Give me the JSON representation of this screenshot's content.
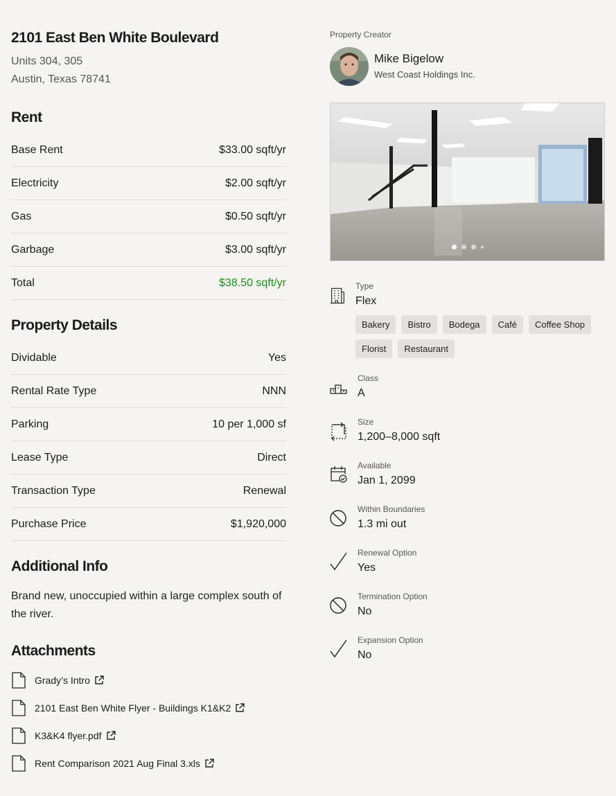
{
  "header": {
    "title": "2101 East Ben White Boulevard",
    "address_line1": "Units 304, 305",
    "address_line2": "Austin, Texas 78741"
  },
  "rent": {
    "heading": "Rent",
    "rows": [
      {
        "label": "Base Rent",
        "value": "$33.00 sqft/yr"
      },
      {
        "label": "Electricity",
        "value": "$2.00 sqft/yr"
      },
      {
        "label": "Gas",
        "value": "$0.50 sqft/yr"
      },
      {
        "label": "Garbage",
        "value": "$3.00 sqft/yr"
      },
      {
        "label": "Total",
        "value": "$38.50 sqft/yr"
      }
    ],
    "total_color": "#1a8c1a"
  },
  "details": {
    "heading": "Property Details",
    "rows": [
      {
        "label": "Dividable",
        "value": "Yes"
      },
      {
        "label": "Rental Rate Type",
        "value": "NNN"
      },
      {
        "label": "Parking",
        "value": "10 per 1,000 sf"
      },
      {
        "label": "Lease Type",
        "value": "Direct"
      },
      {
        "label": "Transaction Type",
        "value": "Renewal"
      },
      {
        "label": "Purchase Price",
        "value": "$1,920,000"
      }
    ]
  },
  "additional": {
    "heading": "Additional Info",
    "text": "Brand new, unoccupied within a large complex south of the river."
  },
  "attachments": {
    "heading": "Attachments",
    "items": [
      {
        "name": "Grady’s Intro",
        "icon": "external-link-icon"
      },
      {
        "name": "2101 East Ben White Flyer - Buildings K1&K2",
        "icon": "external-link-icon"
      },
      {
        "name": "K3&K4 flyer.pdf",
        "icon": "external-link-icon"
      },
      {
        "name": "Rent Comparison 2021 Aug Final 3.xls",
        "icon": "external-link-icon"
      }
    ]
  },
  "creator": {
    "label": "Property Creator",
    "name": "Mike Bigelow",
    "org": "West Coast Holdings Inc."
  },
  "gallery": {
    "page_count": 4,
    "active_index": 0
  },
  "attributes": {
    "type": {
      "label": "Type",
      "value": "Flex",
      "icon": "building-icon",
      "tags": [
        "Bakery",
        "Bistro",
        "Bodega",
        "Café",
        "Coffee Shop",
        "Florist",
        "Restaurant"
      ]
    },
    "class": {
      "label": "Class",
      "value": "A",
      "icon": "podium-icon"
    },
    "size": {
      "label": "Size",
      "value": "1,200–8,000 sqft",
      "icon": "resize-icon"
    },
    "available": {
      "label": "Available",
      "value": "Jan 1, 2099",
      "icon": "calendar-check-icon"
    },
    "within_boundaries": {
      "label": "Within Boundaries",
      "value": "1.3 mi out",
      "icon": "prohibited-icon"
    },
    "renewal_option": {
      "label": "Renewal Option",
      "value": "Yes",
      "icon": "checkmark-icon"
    },
    "termination_option": {
      "label": "Termination Option",
      "value": "No",
      "icon": "prohibited-icon"
    },
    "expansion_option": {
      "label": "Expansion Option",
      "value": "No",
      "icon": "checkmark-icon"
    }
  }
}
